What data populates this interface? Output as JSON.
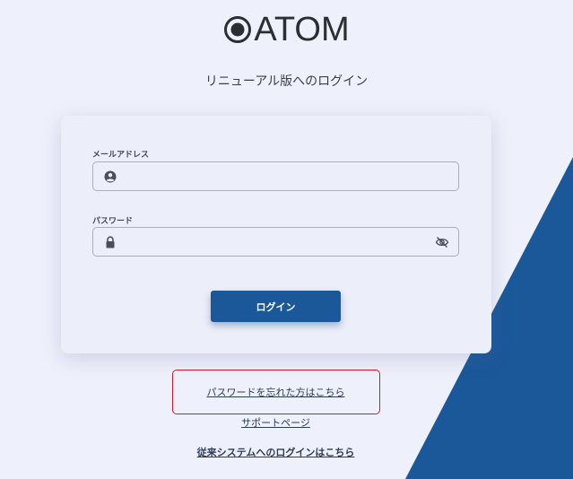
{
  "logo": {
    "text": "ATOM"
  },
  "subtitle": "リニューアル版へのログイン",
  "form": {
    "email_label": "メールアドレス",
    "email_value": "",
    "email_placeholder": "",
    "password_label": "パスワード",
    "password_value": "",
    "password_placeholder": "",
    "login_button": "ログイン"
  },
  "links": {
    "forgot_password": "パスワードを忘れた方はこちら",
    "support": "サポートページ",
    "legacy_login": "従来システムへのログインはこちら"
  },
  "colors": {
    "accent": "#1b5899",
    "background": "#eef0fb",
    "highlight": "#e0141e"
  },
  "icons": {
    "email": "user-circle-icon",
    "password": "lock-icon",
    "toggle_visibility": "eye-slash-icon"
  }
}
